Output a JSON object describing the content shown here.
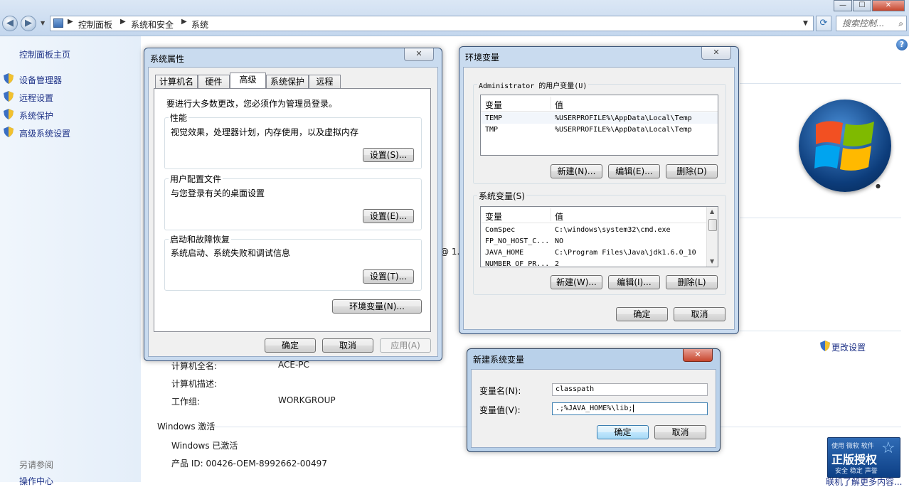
{
  "explorer": {
    "breadcrumb": [
      "控制面板",
      "系统和安全",
      "系统"
    ],
    "search_placeholder": "搜索控制...",
    "controls": {
      "minimize": "—",
      "maximize": "☐",
      "close": "✕"
    }
  },
  "leftnav": {
    "home": "控制面板主页",
    "items": [
      "设备管理器",
      "远程设置",
      "系统保护",
      "高级系统设置"
    ],
    "see_also": "另请参阅",
    "action_center": "操作中心"
  },
  "main": {
    "computer_fullname_label": "计算机全名:",
    "computer_fullname": "ACE-PC",
    "computer_desc_label": "计算机描述:",
    "workgroup_label": "工作组:",
    "workgroup": "WORKGROUP",
    "activation_heading": "Windows 激活",
    "activation_status": "Windows 已激活",
    "product_id": "产品 ID: 00426-OEM-8992662-00497",
    "change_settings": "更改设置",
    "cpu_fragment": "@ 1.",
    "genuine_line1": "使用 微软 软件",
    "genuine_main": "正版授权",
    "genuine_sub": "安全 稳定 声誉",
    "learn_more": "联机了解更多内容..."
  },
  "sysprops": {
    "title": "系统属性",
    "tabs": [
      "计算机名",
      "硬件",
      "高级",
      "系统保护",
      "远程"
    ],
    "admin_note": "要进行大多数更改，您必须作为管理员登录。",
    "perf": {
      "label": "性能",
      "desc": "视觉效果，处理器计划，内存使用，以及虚拟内存",
      "button": "设置(S)..."
    },
    "profile": {
      "label": "用户配置文件",
      "desc": "与您登录有关的桌面设置",
      "button": "设置(E)..."
    },
    "startup": {
      "label": "启动和故障恢复",
      "desc": "系统启动、系统失败和调试信息",
      "button": "设置(T)..."
    },
    "env_button": "环境变量(N)...",
    "ok": "确定",
    "cancel": "取消",
    "apply": "应用(A)"
  },
  "envvars": {
    "title": "环境变量",
    "user_group": "Administrator 的用户变量(U)",
    "col_var": "变量",
    "col_val": "值",
    "user_rows": [
      {
        "name": "TEMP",
        "value": "%USERPROFILE%\\AppData\\Local\\Temp"
      },
      {
        "name": "TMP",
        "value": "%USERPROFILE%\\AppData\\Local\\Temp"
      }
    ],
    "user_new": "新建(N)...",
    "user_edit": "编辑(E)...",
    "user_delete": "删除(D)",
    "sys_group": "系统变量(S)",
    "sys_rows": [
      {
        "name": "ComSpec",
        "value": "C:\\windows\\system32\\cmd.exe"
      },
      {
        "name": "FP_NO_HOST_C...",
        "value": "NO"
      },
      {
        "name": "JAVA_HOME",
        "value": "C:\\Program Files\\Java\\jdk1.6.0_10"
      },
      {
        "name": "NUMBER_OF_PR...",
        "value": "2"
      }
    ],
    "sys_new": "新建(W)...",
    "sys_edit": "编辑(I)...",
    "sys_delete": "删除(L)",
    "ok": "确定",
    "cancel": "取消"
  },
  "newvar": {
    "title": "新建系统变量",
    "name_label": "变量名(N):",
    "name_value": "classpath",
    "value_label": "变量值(V):",
    "value_value": ".;%JAVA_HOME%\\lib;",
    "ok": "确定",
    "cancel": "取消"
  }
}
